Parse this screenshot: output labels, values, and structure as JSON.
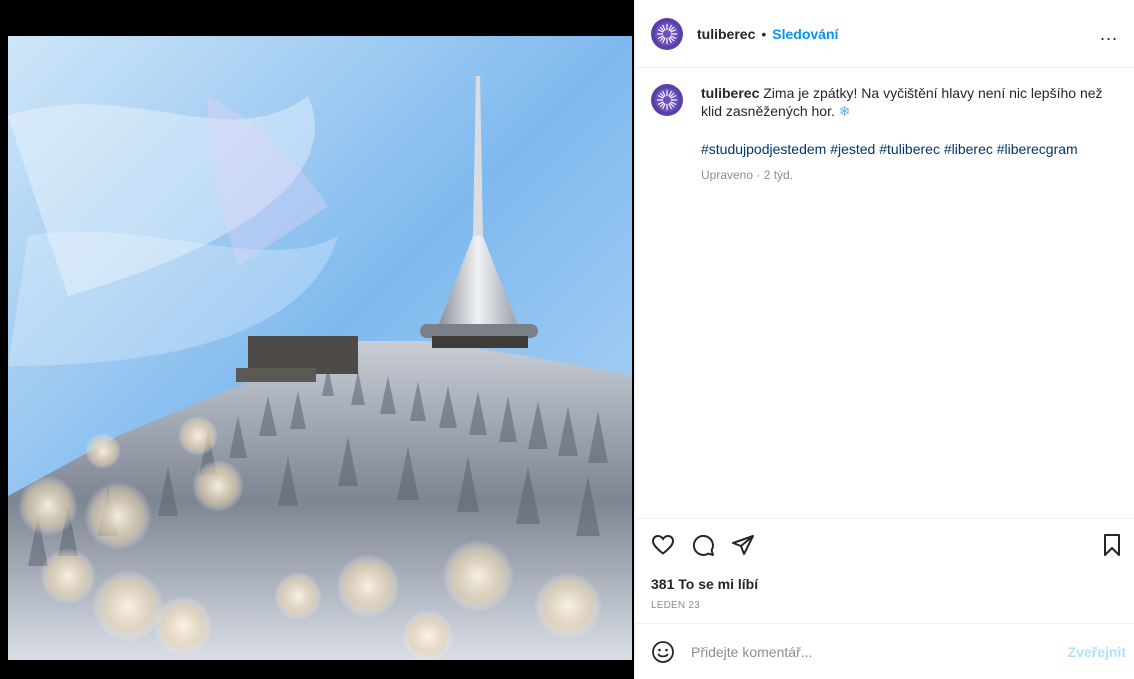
{
  "post": {
    "username": "tuliberec",
    "separator": "•",
    "follow_label": "Sledování",
    "more_label": "...",
    "caption": {
      "username": "tuliberec",
      "text": "Zima je zpátky! Na vyčištění hlavy není nic lepšího než klid zasněžených hor.",
      "emoji": "❄",
      "hashtags": [
        "#studujpodjestedem",
        "#jested",
        "#tuliberec",
        "#liberec",
        "#liberecgram"
      ]
    },
    "edited_label": "Upraveno · 2 týd.",
    "likes_label": "381 To se mi líbí",
    "date_label": "LEDEN 23",
    "comment": {
      "placeholder": "Přidejte komentář...",
      "publish_label": "Zveřejnit"
    },
    "media": {
      "description_colors": {
        "sky": "#8cc4f2",
        "snow": "#d6dde6"
      }
    },
    "icons": [
      "heart-icon",
      "comment-icon",
      "share-icon",
      "bookmark-icon",
      "emoji-icon",
      "avatar-logo-icon"
    ],
    "colors": {
      "accent": "#0095f6",
      "publish_disabled": "#b2dffc",
      "avatar": "#5a3fa6",
      "hashtag": "#00376b",
      "muted": "#8e8e8e"
    }
  }
}
